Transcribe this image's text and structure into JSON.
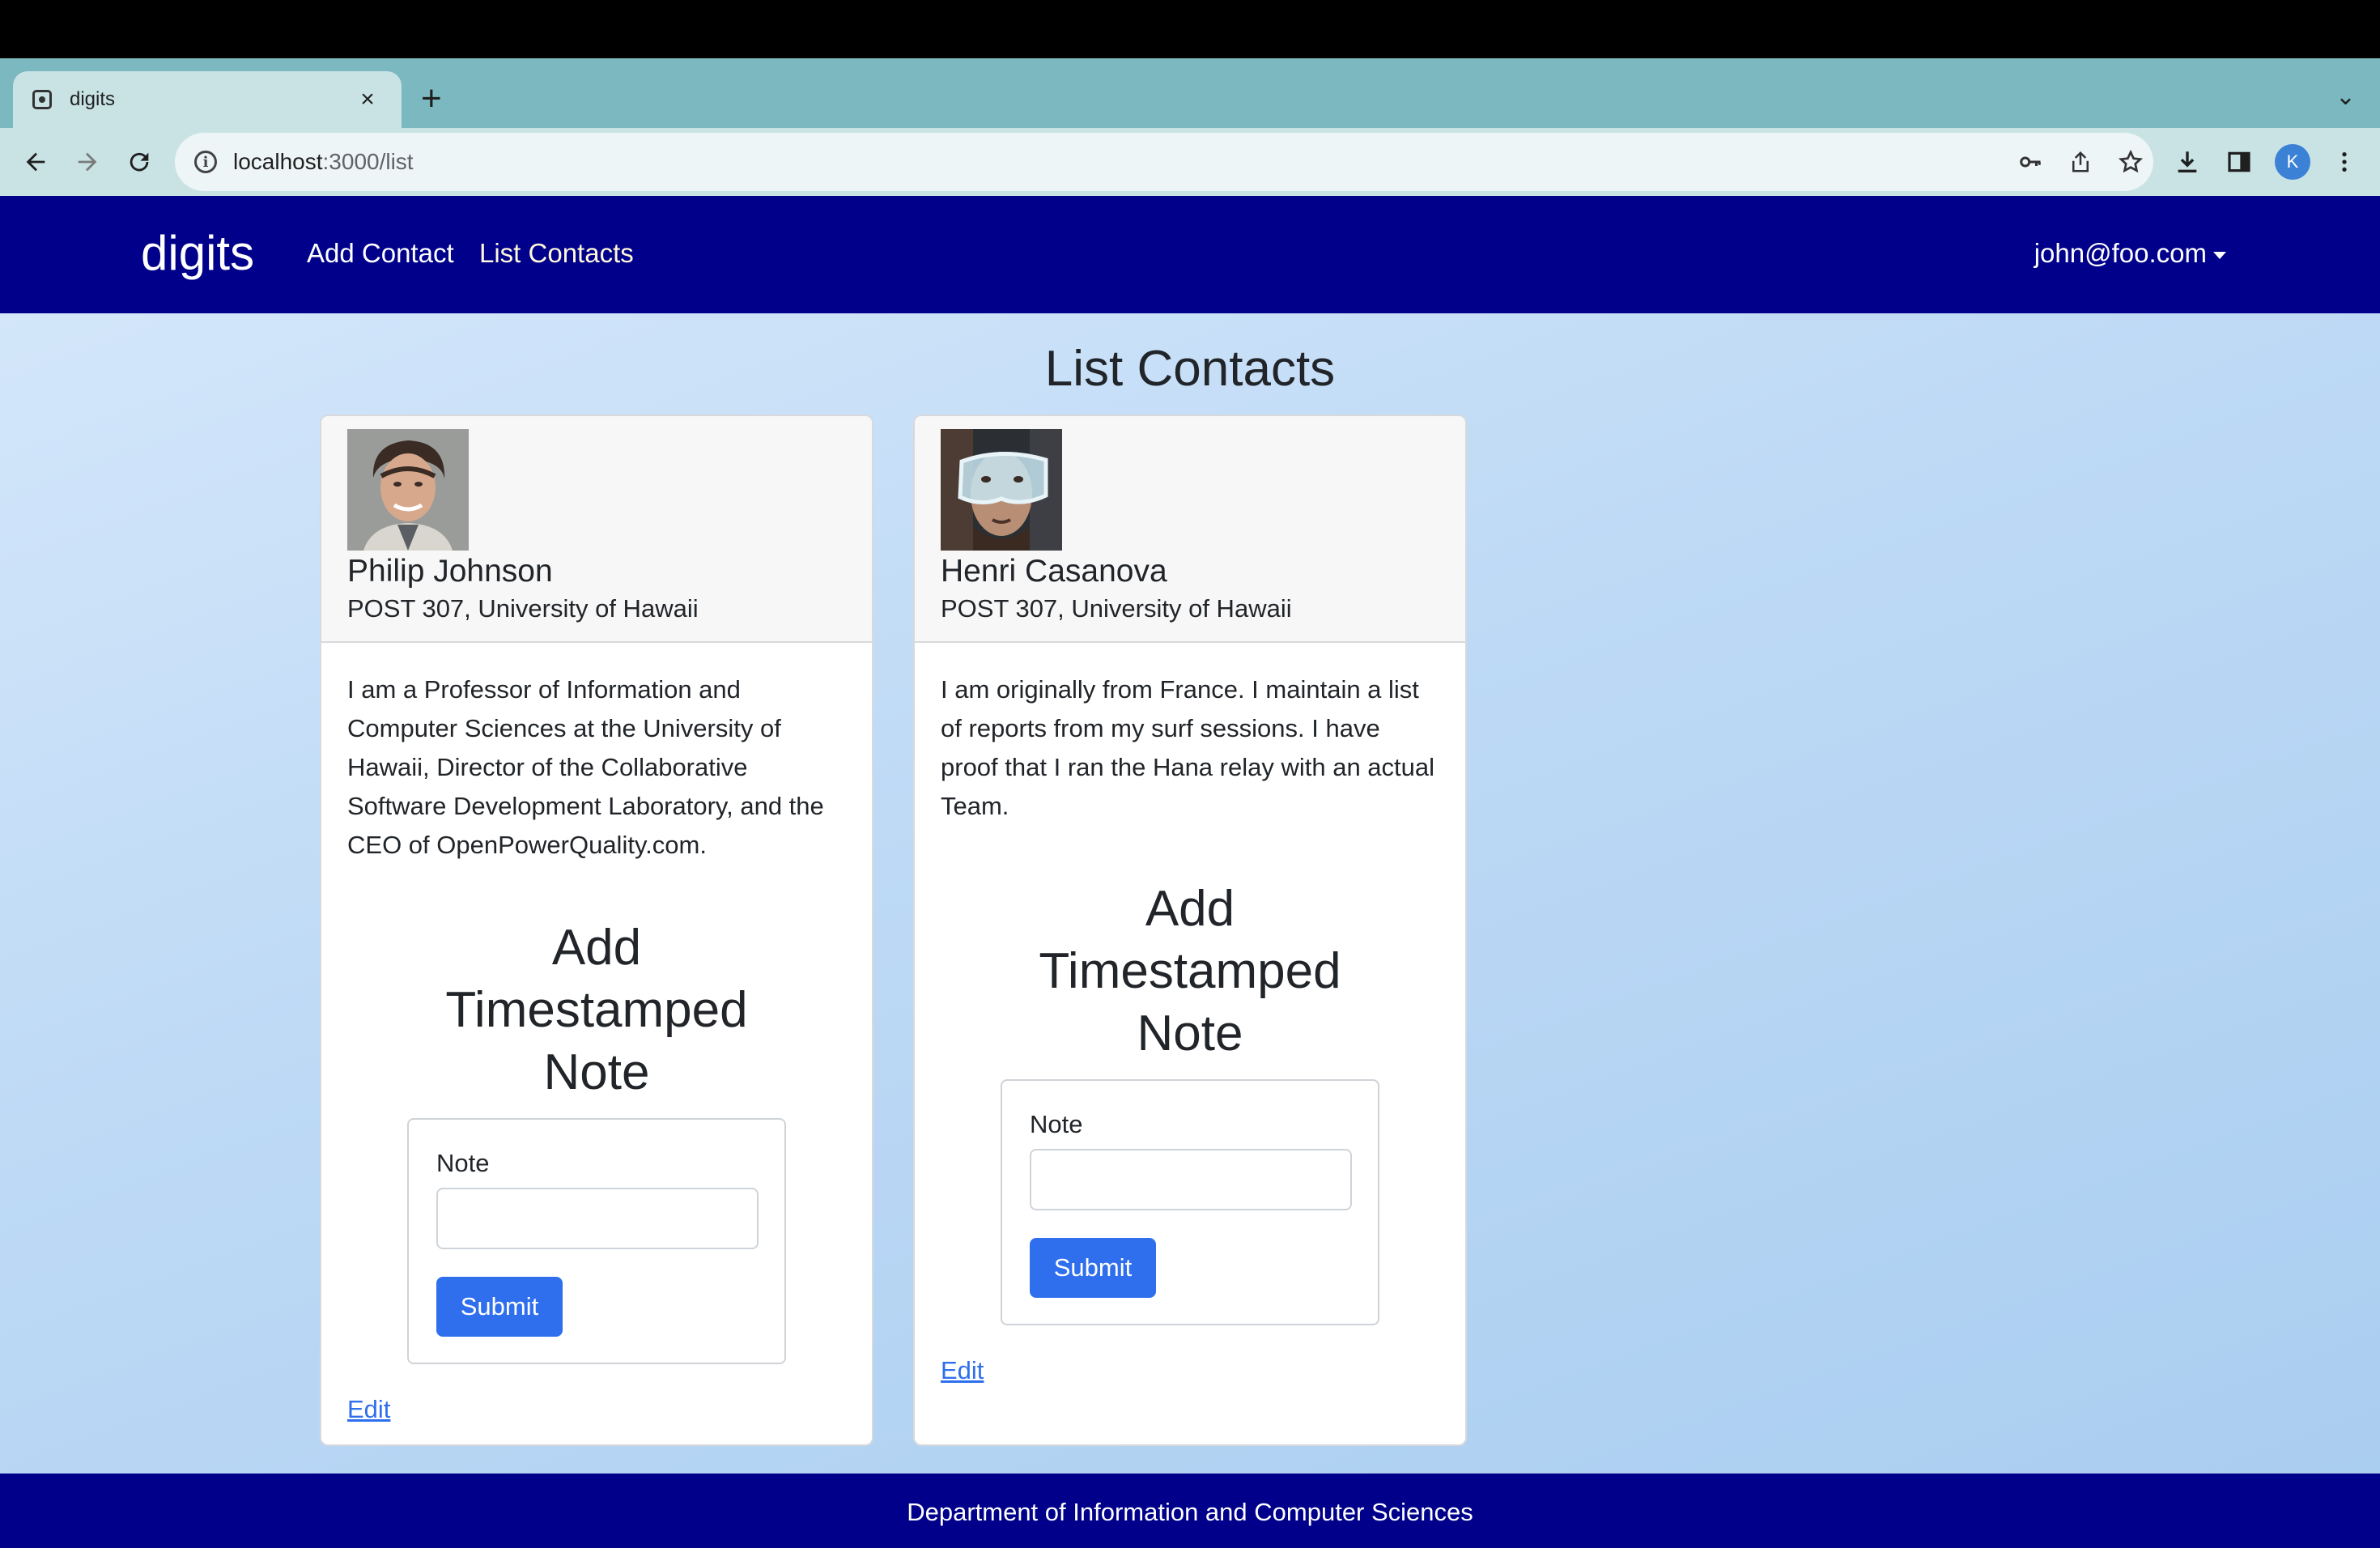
{
  "browser": {
    "tab_title": "digits",
    "tab_close": "×",
    "new_tab": "+",
    "tab_menu": "⌄",
    "url_host": "localhost",
    "url_path": ":3000/list",
    "profile_initial": "K",
    "icons": [
      "back-icon",
      "forward-icon",
      "reload-icon",
      "info-icon",
      "key-icon",
      "share-icon",
      "star-icon",
      "download-icon",
      "side-panel-icon",
      "kebab-menu-icon"
    ]
  },
  "navbar": {
    "brand": "digits",
    "links": [
      "Add Contact",
      "List Contacts"
    ],
    "active_link": "List Contacts",
    "user": "john@foo.com"
  },
  "page": {
    "title": "List Contacts"
  },
  "contacts": [
    {
      "name": "Philip Johnson",
      "address": "POST 307, University of Hawaii",
      "description": "I am a Professor of Information and Computer Sciences at the University of Hawaii, Director of the Collaborative Software Development Laboratory, and the CEO of OpenPowerQuality.com.",
      "note_title": "Add Timestamped Note",
      "note_label": "Note",
      "note_value": "",
      "submit_label": "Submit",
      "edit_label": "Edit"
    },
    {
      "name": "Henri Casanova",
      "address": "POST 307, University of Hawaii",
      "description": "I am originally from France. I maintain a list of reports from my surf sessions. I have proof that I ran the Hana relay with an actual Team.",
      "note_title": "Add Timestamped Note",
      "note_label": "Note",
      "note_value": "",
      "submit_label": "Submit",
      "edit_label": "Edit"
    }
  ],
  "footer": {
    "text": "Department of Information and Computer Sciences"
  },
  "colors": {
    "navbar": "#00008b",
    "button": "#2f6fed",
    "page_bg": "#bdd9f5"
  }
}
